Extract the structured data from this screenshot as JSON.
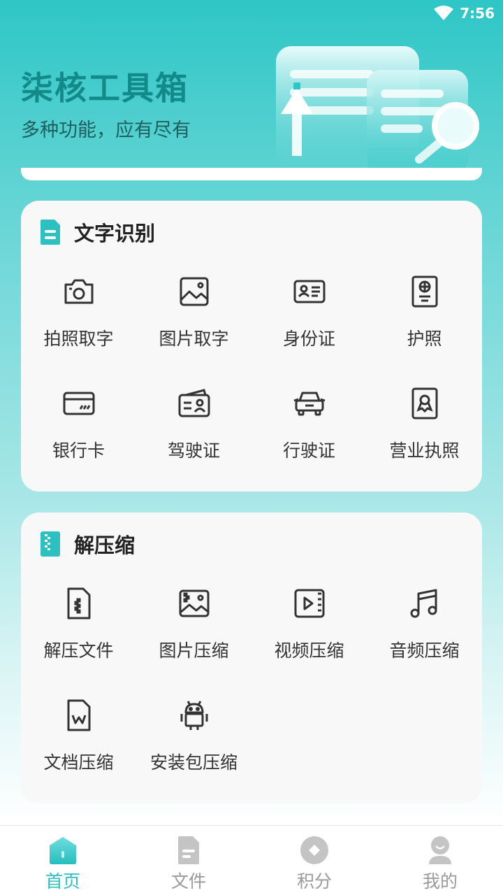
{
  "status_bar": {
    "time": "7:56"
  },
  "hero": {
    "title": "柒核工具箱",
    "subtitle": "多种功能，应有尽有"
  },
  "sections": [
    {
      "title": "文字识别",
      "icon": "document-icon",
      "items": [
        {
          "label": "拍照取字",
          "icon": "camera-icon"
        },
        {
          "label": "图片取字",
          "icon": "image-icon"
        },
        {
          "label": "身份证",
          "icon": "id-card-icon"
        },
        {
          "label": "护照",
          "icon": "passport-icon"
        },
        {
          "label": "银行卡",
          "icon": "bank-card-icon"
        },
        {
          "label": "驾驶证",
          "icon": "driver-license-icon"
        },
        {
          "label": "行驶证",
          "icon": "car-icon"
        },
        {
          "label": "营业执照",
          "icon": "business-license-icon"
        }
      ]
    },
    {
      "title": "解压缩",
      "icon": "zip-icon",
      "items": [
        {
          "label": "解压文件",
          "icon": "zip-file-icon"
        },
        {
          "label": "图片压缩",
          "icon": "image-compress-icon"
        },
        {
          "label": "视频压缩",
          "icon": "video-icon"
        },
        {
          "label": "音频压缩",
          "icon": "music-icon"
        },
        {
          "label": "文档压缩",
          "icon": "word-doc-icon"
        },
        {
          "label": "安装包压缩",
          "icon": "android-icon"
        }
      ]
    }
  ],
  "tabbar": {
    "tabs": [
      {
        "label": "首页",
        "icon": "home-icon",
        "active": true
      },
      {
        "label": "文件",
        "icon": "file-icon",
        "active": false
      },
      {
        "label": "积分",
        "icon": "points-icon",
        "active": false
      },
      {
        "label": "我的",
        "icon": "profile-icon",
        "active": false
      }
    ]
  },
  "colors": {
    "accent": "#2cc0c0",
    "title": "#138a8a",
    "inactive": "#9a9a9a"
  }
}
